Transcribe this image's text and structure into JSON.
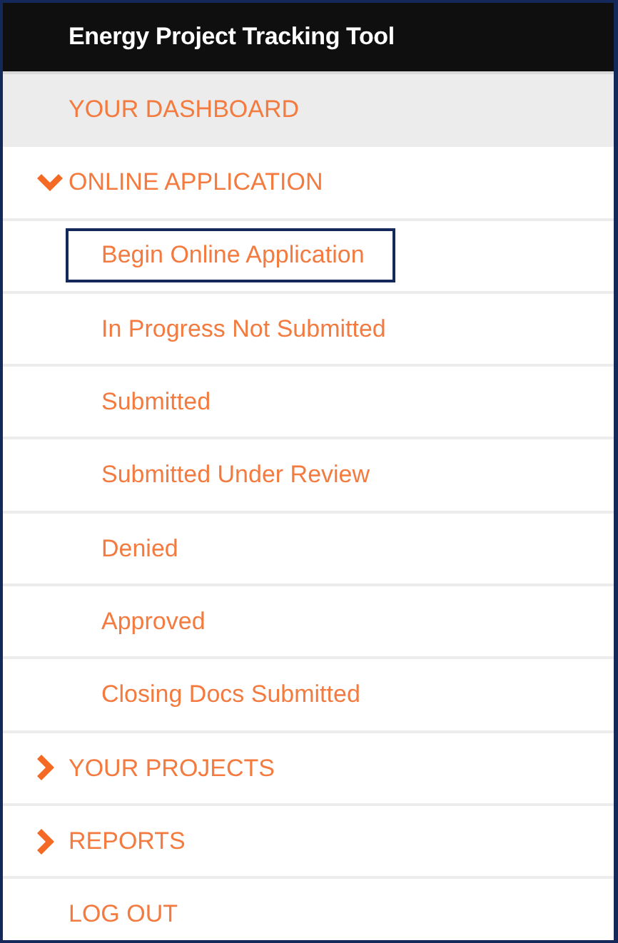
{
  "header": {
    "title": "Energy Project Tracking Tool"
  },
  "menu": [
    {
      "label": "YOUR DASHBOARD",
      "kind": "link",
      "selected": true
    },
    {
      "label": "ONLINE APPLICATION",
      "kind": "group",
      "expanded": true,
      "selected": false,
      "children": [
        {
          "label": "Begin Online Application",
          "focused": true
        },
        {
          "label": "In Progress Not Submitted",
          "focused": false
        },
        {
          "label": "Submitted",
          "focused": false
        },
        {
          "label": "Submitted Under Review",
          "focused": false
        },
        {
          "label": "Denied",
          "focused": false
        },
        {
          "label": "Approved",
          "focused": false
        },
        {
          "label": "Closing Docs Submitted",
          "focused": false
        }
      ]
    },
    {
      "label": "YOUR PROJECTS",
      "kind": "group",
      "expanded": false,
      "selected": false
    },
    {
      "label": "REPORTS",
      "kind": "group",
      "expanded": false,
      "selected": false
    },
    {
      "label": "LOG OUT",
      "kind": "link",
      "selected": false
    }
  ]
}
